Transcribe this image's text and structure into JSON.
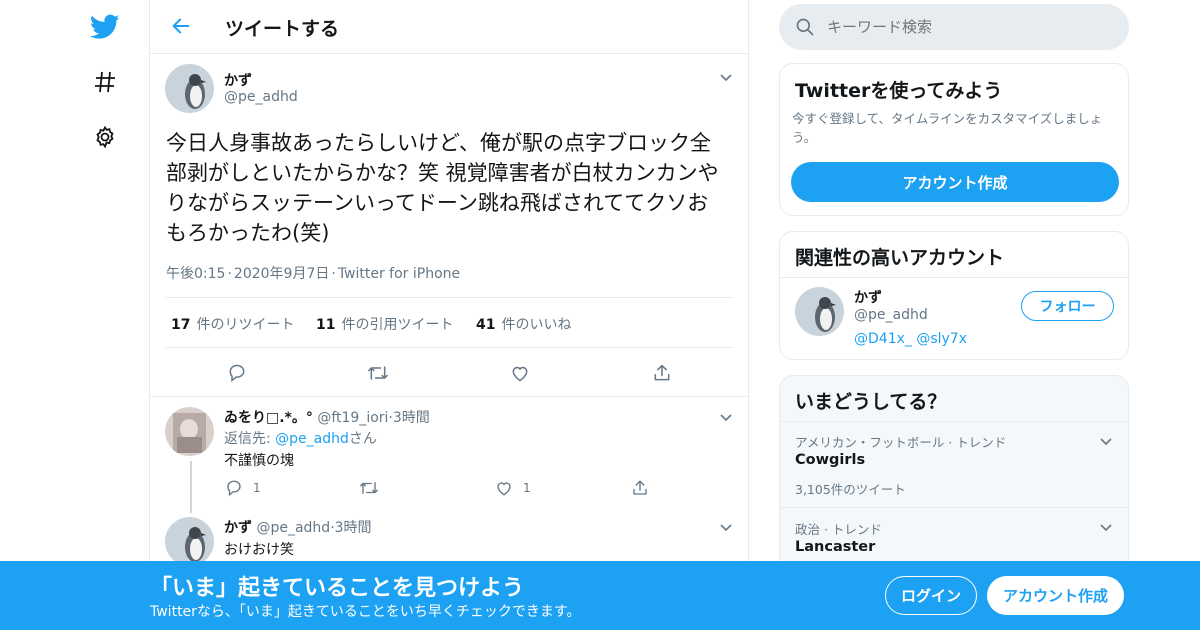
{
  "header": {
    "title": "ツイートする"
  },
  "tweet": {
    "name": "かず",
    "handle": "@pe_adhd",
    "text": "今日人身事故あったらしいけど、俺が駅の点字ブロック全部剥がしといたからかな？笑 視覚障害者が白杖カンカンやりながらスッテーンいってドーン跳ね飛ばされててクソおもろかったわ(笑)",
    "time": "午後0:15",
    "date": "2020年9月7日",
    "client": "Twitter for iPhone",
    "sep": "·",
    "retweets_count": "17",
    "retweets_label": "件のリツイート",
    "quotes_count": "11",
    "quotes_label": "件の引用ツイート",
    "likes_count": "41",
    "likes_label": "件のいいね"
  },
  "replies": [
    {
      "name": "ゐをり□.*。°",
      "handle": "@ft19_iori",
      "time": "3時間",
      "reply_to_prefix": "返信先: ",
      "reply_to_handle": "@pe_adhd",
      "reply_to_suffix": "さん",
      "text": "不謹慎の塊",
      "reply_count": "1",
      "like_count": "1"
    },
    {
      "name": "かず",
      "handle": "@pe_adhd",
      "time": "3時間",
      "text": "おけおけ笑"
    }
  ],
  "search": {
    "placeholder": "キーワード検索"
  },
  "signup_card": {
    "title": "Twitterを使ってみよう",
    "subtitle": "今すぐ登録して、タイムラインをカスタマイズしましょう。",
    "button": "アカウント作成"
  },
  "related_card": {
    "title": "関連性の高いアカウント",
    "name": "かず",
    "handle": "@pe_adhd",
    "mentions": "@D41x_ @sly7x",
    "follow": "フォロー"
  },
  "trends_card": {
    "title": "いまどうしてる？",
    "items": [
      {
        "category": "アメリカン・フットボール · トレンド",
        "name": "Cowgirls",
        "count": "3,105件のツイート"
      },
      {
        "category": "政治 · トレンド",
        "name": "Lancaster"
      }
    ]
  },
  "banner": {
    "title": "「いま」起きていることを見つけよう",
    "subtitle": "Twitterなら、「いま」起きていることをいち早くチェックできます。",
    "login": "ログイン",
    "signup": "アカウント作成"
  },
  "colors": {
    "accent": "#1da1f2",
    "text": "#14171a",
    "muted": "#657786",
    "border": "#e6ecf0"
  }
}
